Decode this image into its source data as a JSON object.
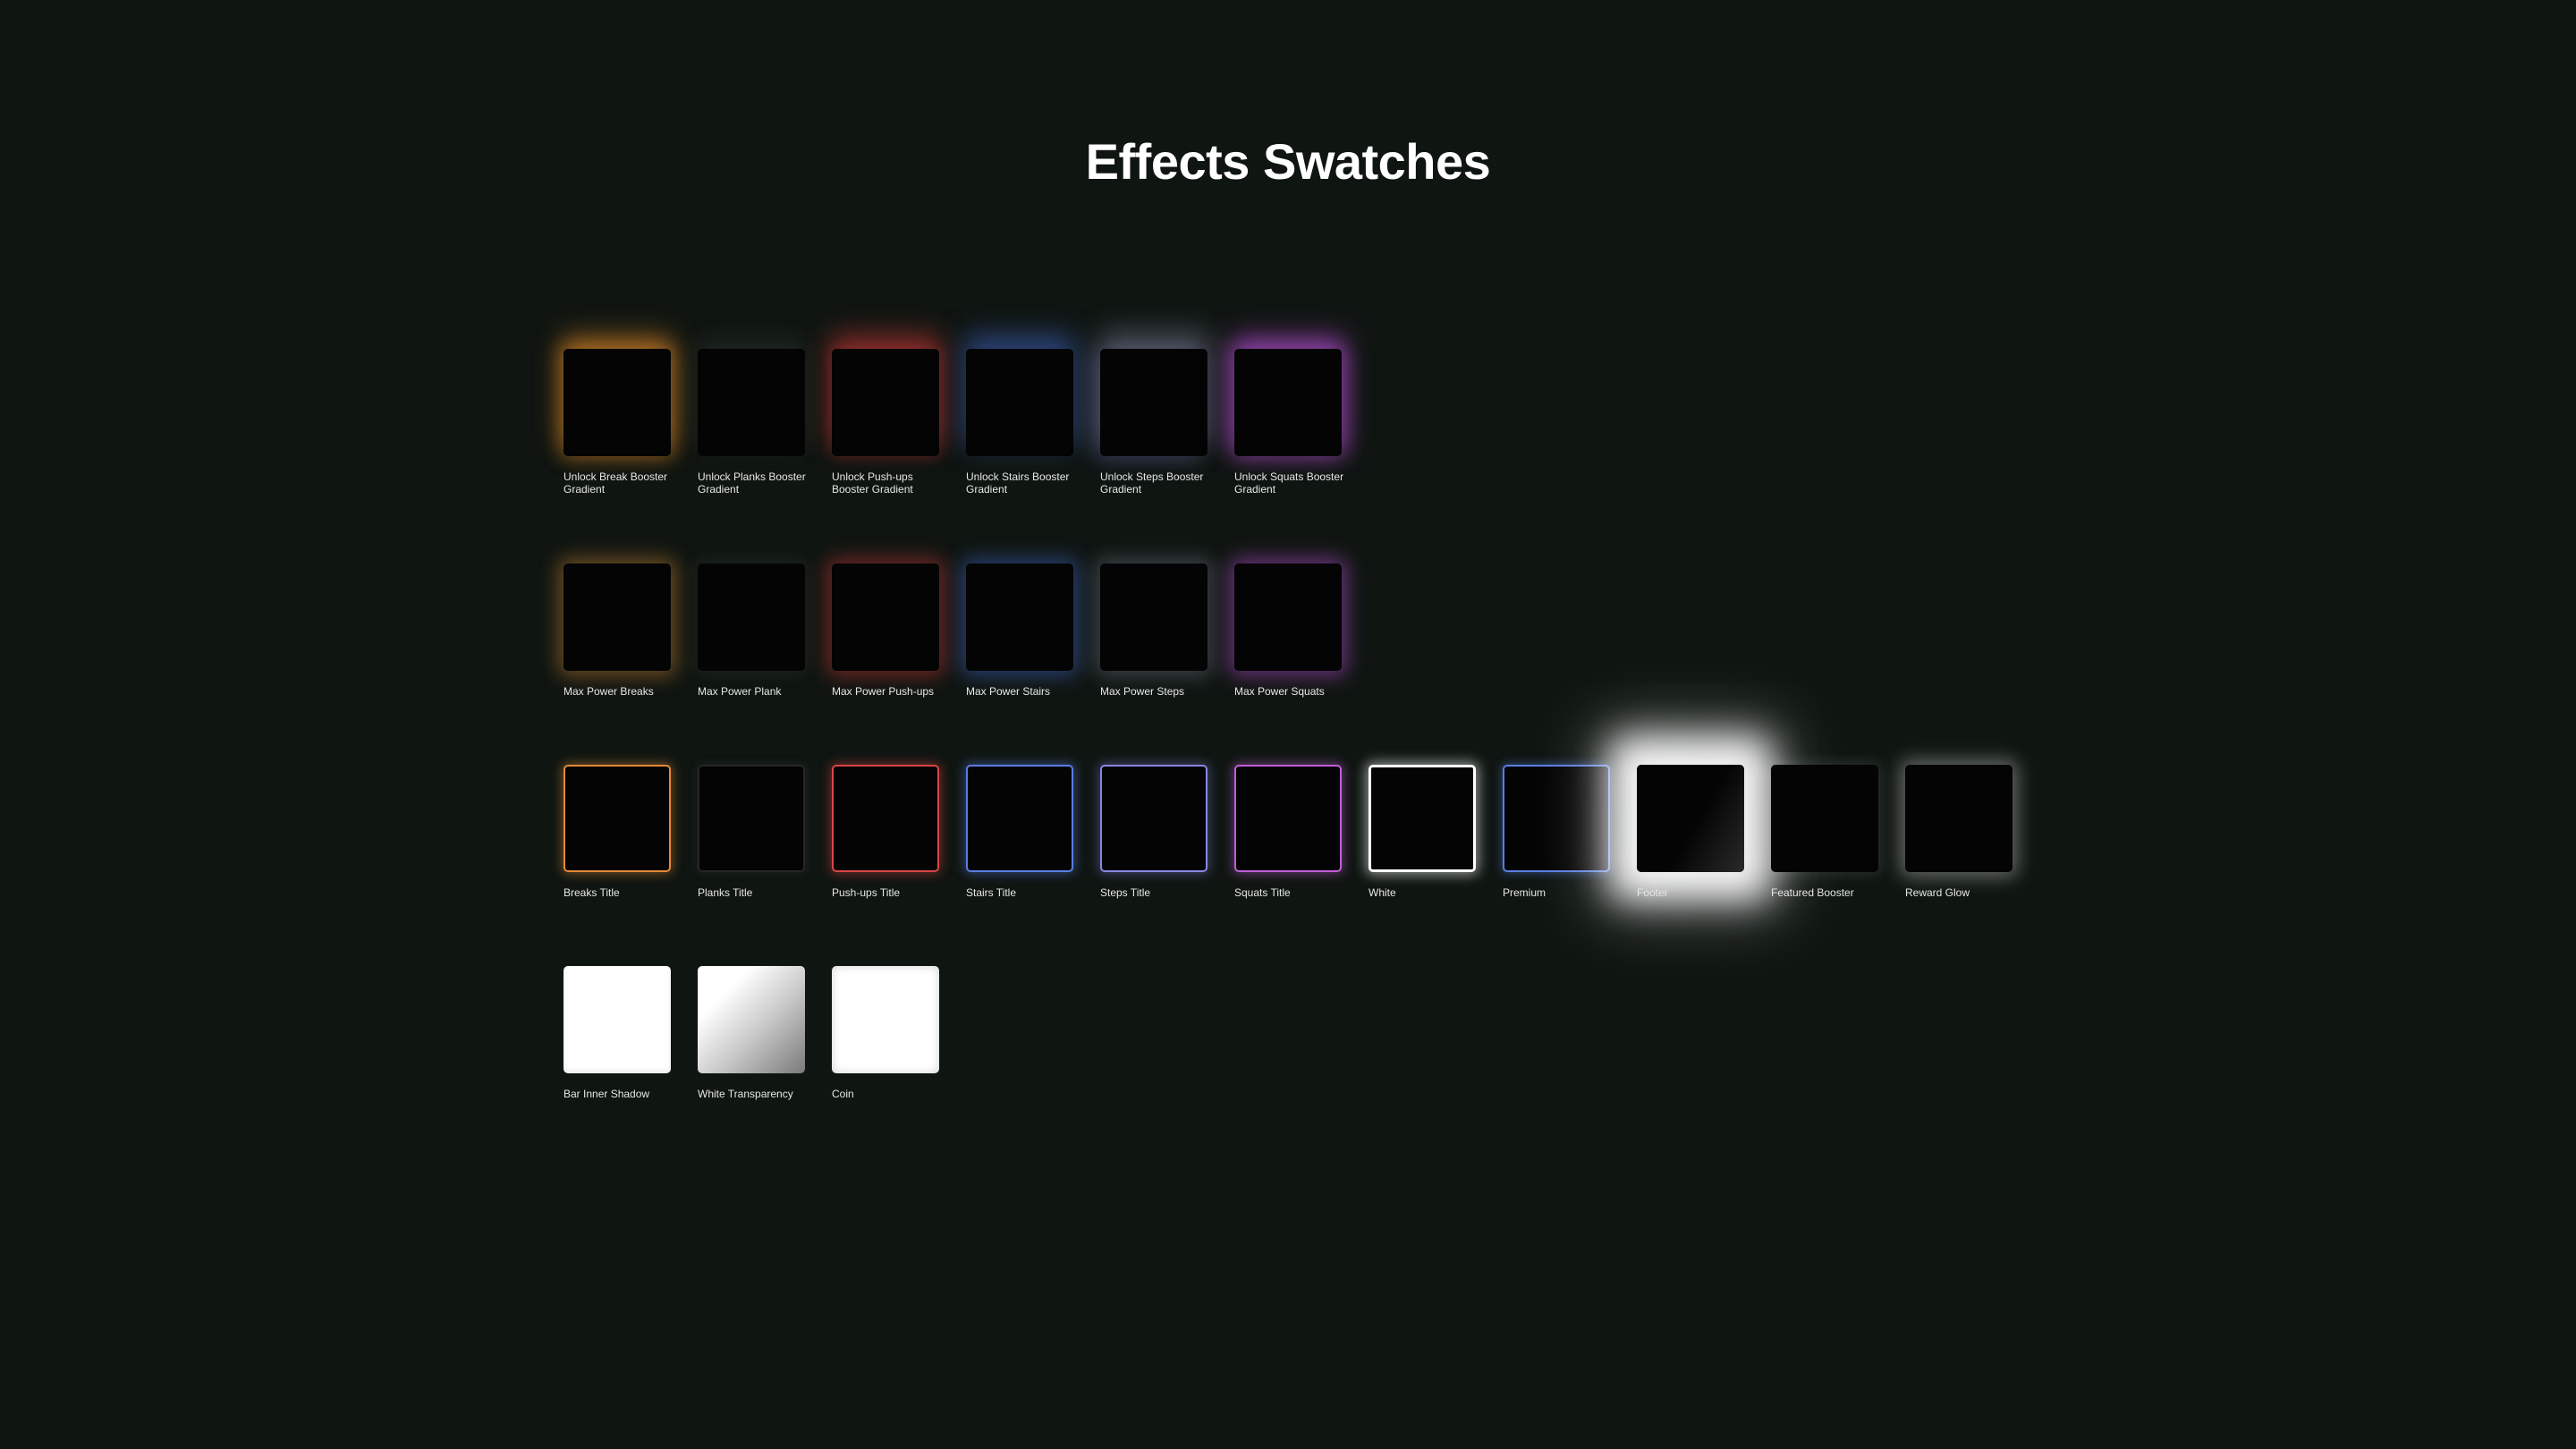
{
  "title": "Effects Swatches",
  "rows": [
    {
      "name": "unlock-booster-gradients",
      "swatches": [
        {
          "id": "unlock-break",
          "label": "Unlock Break Booster Gradient",
          "color": "#f2922a"
        },
        {
          "id": "unlock-planks",
          "label": "Unlock Planks Booster Gradient",
          "color": "#969696"
        },
        {
          "id": "unlock-pushups",
          "label": "Unlock Push-ups Booster Gradient",
          "color": "#dc3c3c"
        },
        {
          "id": "unlock-stairs",
          "label": "Unlock Stairs Booster Gradient",
          "color": "#466edc"
        },
        {
          "id": "unlock-steps",
          "label": "Unlock Steps Booster Gradient",
          "color": "#b4b4dc"
        },
        {
          "id": "unlock-squats",
          "label": "Unlock Squats Booster Gradient",
          "color": "#be50dc"
        }
      ]
    },
    {
      "name": "max-power",
      "swatches": [
        {
          "id": "max-breaks",
          "label": "Max Power Breaks",
          "color": "#eb963c"
        },
        {
          "id": "max-plank",
          "label": "Max Power Plank",
          "color": "#8c8c8c"
        },
        {
          "id": "max-pushups",
          "label": "Max Power Push-ups",
          "color": "#dc3c3c"
        },
        {
          "id": "max-stairs",
          "label": "Max Power Stairs",
          "color": "#466edc"
        },
        {
          "id": "max-steps",
          "label": "Max Power Steps",
          "color": "#b4b4d2"
        },
        {
          "id": "max-squats",
          "label": "Max Power Squats",
          "color": "#be50dc"
        }
      ]
    },
    {
      "name": "titles",
      "swatches": [
        {
          "id": "breaks-title",
          "label": "Breaks Title",
          "color": "#e28a3a"
        },
        {
          "id": "planks-title",
          "label": "Planks Title",
          "color": "#262626"
        },
        {
          "id": "pushups-title",
          "label": "Push-ups Title",
          "color": "#d94545"
        },
        {
          "id": "stairs-title",
          "label": "Stairs Title",
          "color": "#5a7ee0"
        },
        {
          "id": "steps-title",
          "label": "Steps Title",
          "color": "#8a86e0"
        },
        {
          "id": "squats-title",
          "label": "Squats Title",
          "color": "#c05ed6"
        },
        {
          "id": "white",
          "label": "White",
          "color": "#ffffff"
        },
        {
          "id": "premium",
          "label": "Premium",
          "color": "#5a7ee0"
        },
        {
          "id": "footer",
          "label": "Footer",
          "color": "#ffffff"
        },
        {
          "id": "featured-booster",
          "label": "Featured Booster",
          "color": "#ffffff"
        },
        {
          "id": "reward-glow",
          "label": "Reward Glow",
          "color": "#ffffff"
        }
      ]
    },
    {
      "name": "light",
      "swatches": [
        {
          "id": "bar-inner-shadow",
          "label": "Bar Inner Shadow",
          "color": "#ffffff"
        },
        {
          "id": "white-transparency",
          "label": "White Transparency",
          "color": "#ffffff"
        },
        {
          "id": "coin",
          "label": "Coin",
          "color": "#ffffff"
        }
      ]
    }
  ],
  "background_color": "#0f1511"
}
